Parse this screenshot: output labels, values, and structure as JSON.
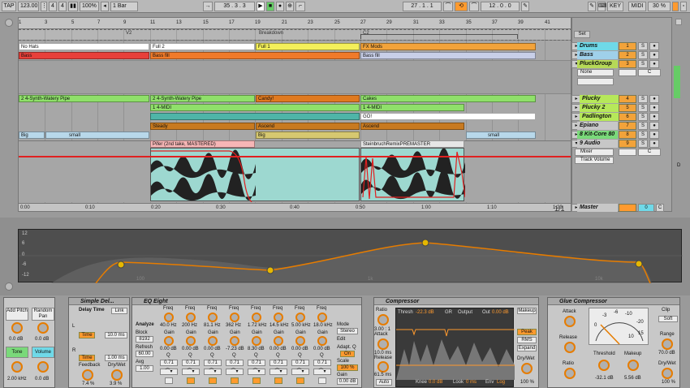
{
  "transport": {
    "tap": "TAP",
    "tempo": "123.00",
    "sig_num": "4",
    "sig_den": "4",
    "zoom": "100%",
    "quant": "1 Bar",
    "position": "35 .   3 .   3",
    "loop_start": "27 .   1 .   1",
    "loop_length": "12 .   0 .   0",
    "key": "KEY",
    "midi": "MIDI",
    "cpu": "30 %",
    "d_label": "D"
  },
  "ruler": {
    "bars": [
      "1",
      "3",
      "5",
      "7",
      "9",
      "11",
      "13",
      "15",
      "17",
      "19",
      "21",
      "23",
      "25",
      "27",
      "29",
      "31",
      "33",
      "35",
      "37",
      "39",
      "41"
    ],
    "times": [
      "0:00",
      "0:10",
      "0:20",
      "0:30",
      "0:40",
      "0:50",
      "1:00",
      "1:10",
      "1:20"
    ],
    "page": "1/1"
  },
  "locators": [
    "V2",
    "Breakdown",
    "C2"
  ],
  "clips": {
    "r1": [
      "No Hats",
      "Full 2",
      "Full 1",
      "FX Mods"
    ],
    "r2": [
      "Bass",
      "Bass fill",
      "Bass fill"
    ],
    "r3": [
      "2 4-Synth-Watery Pipe",
      "2 4-Synth-Watery Pipe",
      "Candy!",
      "Cakes"
    ],
    "r4": [
      "1 4-MIDI",
      "1 4-MIDI"
    ],
    "r5": [
      "GO!"
    ],
    "r6": [
      "Steady",
      "Ascend",
      "Ascend"
    ],
    "r7": [
      "Big",
      "small",
      "Big",
      "small"
    ],
    "audio": [
      "Pifer (2nd take, MASTERED)",
      "SteinbruchRemixPREMASTER"
    ]
  },
  "tracks": [
    {
      "name": "Drums",
      "num": "1",
      "c": "#6fd9e8"
    },
    {
      "name": "Bass",
      "num": "2",
      "c": "#9fd0ea"
    },
    {
      "name": "PluckGroup",
      "num": "3",
      "c": "#b6d957"
    },
    {
      "name": "Plucky",
      "num": "4",
      "c": "#b6e85a"
    },
    {
      "name": "Plucky 2",
      "num": "5",
      "c": "#b6e85a"
    },
    {
      "name": "Padlington",
      "num": "6",
      "c": "#b6e85a"
    },
    {
      "name": "Epiano",
      "num": "7",
      "c": "#c7c7c7"
    },
    {
      "name": "8 Kit-Core 80",
      "num": "8",
      "c": "#7ad97a"
    },
    {
      "name": "9 Audio",
      "num": "9",
      "c": "#c7c7c7"
    },
    {
      "name": "Master",
      "num": "0",
      "c": "#c7c7c7"
    }
  ],
  "track_sub": {
    "none": "None",
    "mixer": "Mixer",
    "track_volume": "Track Volume",
    "s": "S",
    "c": "C",
    "set": "Set"
  },
  "eq_axis": {
    "y": [
      "12",
      "6",
      "0",
      "-6",
      "-12"
    ],
    "x": [
      "100",
      "1k",
      "10k"
    ]
  },
  "devices": {
    "instr": {
      "add_pitch": "Add Pitch",
      "random_pan": "Random Pan",
      "v1": "0.0 dB",
      "v2": "0.0 dB",
      "tone": "Tone",
      "volume": "Volume",
      "v3": "2.00 kHz",
      "v4": "0.0 dB"
    },
    "delay": {
      "title": "Simple Del...",
      "delay_time": "Delay Time",
      "link": "Link",
      "l": "L",
      "r": "R",
      "time1": "Time",
      "ms1": "10.0 ms",
      "time2": "Time",
      "ms2": "1.00 ms",
      "feedback": "Feedback",
      "drywet": "Dry/Wet",
      "fb": "7.4 %",
      "dw": "3.9 %"
    },
    "eq": {
      "title": "EQ Eight",
      "analyze": "Analyze",
      "block": "Block",
      "block_v": "8192",
      "refresh": "Refresh",
      "refresh_v": "60.00",
      "avg": "Avg",
      "avg_v": "1.00",
      "mode": "Mode",
      "mode_v": "Stereo",
      "edit": "Edit",
      "adapt": "Adapt. Q",
      "on": "On",
      "scale": "Scale",
      "scale_v": "100 %",
      "gain": "Gain",
      "gain_v": "0.00 dB",
      "bands": [
        {
          "f": "40.0 Hz",
          "g": "0.00 dB",
          "q": "0.71"
        },
        {
          "f": "200 Hz",
          "g": "0.00 dB",
          "q": "0.71"
        },
        {
          "f": "81.1 Hz",
          "g": "0.00 dB",
          "q": "0.71"
        },
        {
          "f": "362 Hz",
          "g": "-7.23 dB",
          "q": "0.71"
        },
        {
          "f": "1.72 kHz",
          "g": "8.30 dB",
          "q": "0.71"
        },
        {
          "f": "14.5 kHz",
          "g": "0.00 dB",
          "q": "0.71"
        },
        {
          "f": "5.00 kHz",
          "g": "0.00 dB",
          "q": "0.71"
        },
        {
          "f": "18.0 kHz",
          "g": "0.00 dB",
          "q": "0.71"
        }
      ],
      "freq": "Freq",
      "q": "Q"
    },
    "comp": {
      "title": "Compressor",
      "ratio": "Ratio",
      "ratio_v": "3.00 : 1",
      "attack": "Attack",
      "attack_v": "10.0 ms",
      "release": "Release",
      "release_v": "61.5 ms",
      "auto": "Auto",
      "thresh": "Thresh",
      "thresh_v": "-22.3 dB",
      "gr": "GR",
      "output": "Output",
      "out": "Out",
      "out_v": "0.00 dB",
      "makeup": "Makeup",
      "peak": "Peak",
      "rms": "RMS",
      "expand": "Expand",
      "knee": "Knee",
      "knee_v": "0.0 dB",
      "look": "Look",
      "look_v": "0 ms",
      "env": "Env",
      "env_v": "Log",
      "drywet": "Dry/Wet",
      "dw_v": "100 %"
    },
    "glue": {
      "title": "Glue Compressor",
      "attack": "Attack",
      "release": "Release",
      "ratio": "Ratio",
      "clip": "Clip",
      "soft": "Soft",
      "range": "Range",
      "range_v": "70.0 dB",
      "threshold": "Threshold",
      "thr_v": "-32.1 dB",
      "makeup": "Makeup",
      "mk_v": "5.56 dB",
      "drywet": "Dry/Wet",
      "dw_v": "100 %",
      "scale": [
        "0",
        "-3",
        "-6",
        "-10",
        "-20",
        "15",
        "10"
      ]
    }
  }
}
